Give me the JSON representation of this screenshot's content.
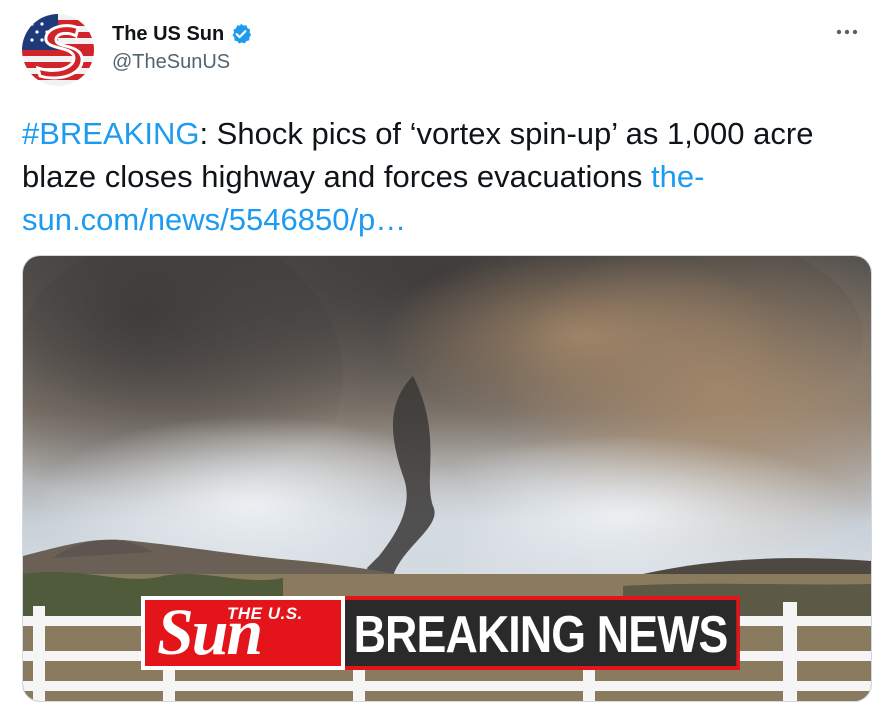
{
  "tweet": {
    "author": {
      "display_name": "The US Sun",
      "handle": "@TheSunUS",
      "verified": true,
      "avatar_icon": "us-sun-logo-avatar"
    },
    "more_icon": "more-dots-icon",
    "text": {
      "hashtag": "#BREAKING",
      "body": ": Shock pics of ‘vortex spin-up’ as 1,000 acre blaze closes highway and forces evacuations ",
      "link": "the-sun.com/news/5546850/p…"
    },
    "media": {
      "banner_logo_top": "THE U.S.",
      "banner_logo_big": "Sun",
      "banner_text": "BREAKING NEWS"
    }
  },
  "colors": {
    "link": "#1d9bf0",
    "text": "#0f1419",
    "secondary": "#536471",
    "verified": "#1d9bf0",
    "banner_red": "#e3151a"
  }
}
